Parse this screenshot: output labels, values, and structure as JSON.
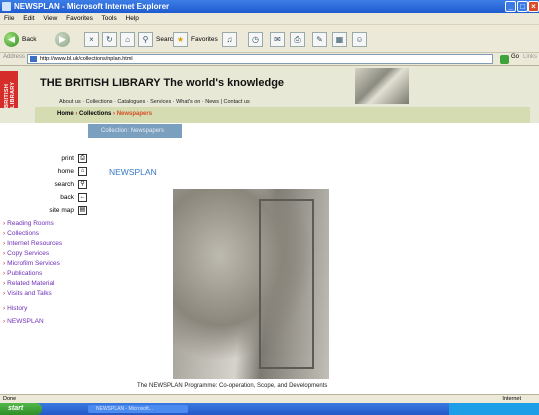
{
  "window": {
    "title": "NEWSPLAN - Microsoft Internet Explorer",
    "min": "_",
    "max": "□",
    "close": "×"
  },
  "menu": [
    "File",
    "Edit",
    "View",
    "Favorites",
    "Tools",
    "Help"
  ],
  "toolbar": {
    "back": "Back",
    "search": "Search",
    "favorites": "Favorites"
  },
  "address": {
    "label": "Address",
    "url": "http://www.bl.uk/collections/nplan.html",
    "go": "Go",
    "links": "Links"
  },
  "site": {
    "logo": "BRITISH LIBRARY",
    "title": "THE BRITISH LIBRARY   The world's knowledge",
    "nav": "About us · Collections · Catalogues · Services · What's on · News | Contact us",
    "breadcrumb": {
      "home": "Home",
      "collections": "Collections",
      "current": "Newspapers"
    },
    "subtab": "Collection: Newspapers"
  },
  "tools": [
    "print",
    "home",
    "search",
    "back",
    "site map"
  ],
  "sidebar": [
    "Reading Rooms",
    "Collections",
    "Internet Resources",
    "Copy Services",
    "Microfilm Services",
    "Publications",
    "Related Material",
    "Visits and Talks",
    "History",
    "NEWSPLAN"
  ],
  "page": {
    "heading": "NEWSPLAN",
    "caption": "The NEWSPLAN Programme: Co-operation, Scope, and Developments"
  },
  "status": {
    "left": "Done",
    "right": "Internet"
  },
  "taskbar": {
    "start": "start",
    "item": "NEWSPLAN - Microsoft..."
  }
}
